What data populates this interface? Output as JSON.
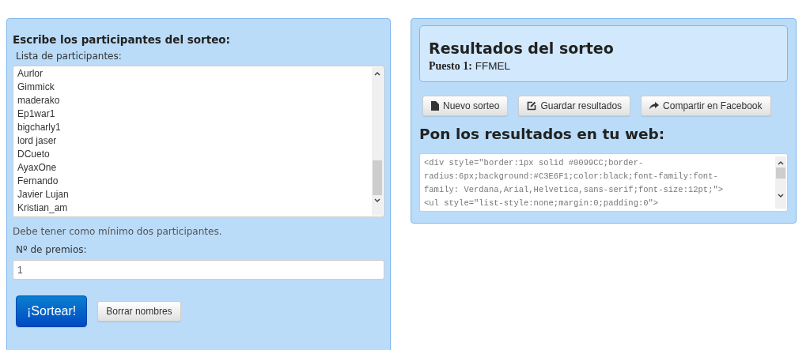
{
  "participants_panel": {
    "heading": "Escribe los participantes del sorteo:",
    "list_label": "Lista de participantes:",
    "participants": [
      "Aurlor",
      "Gimmick",
      "maderako",
      "Ep1war1",
      "bigcharly1",
      "lord jaser",
      "DCueto",
      "AyaxOne",
      "Fernando",
      "Javier Lujan",
      "Kristian_am"
    ],
    "hint": "Debe tener como mínimo dos participantes.",
    "prizes_label": "Nº de premios:",
    "prizes_value": "1",
    "buttons": [
      {
        "label": "¡Sortear!",
        "kind": "primary"
      },
      {
        "label": "Borrar nombres",
        "kind": "default"
      }
    ]
  },
  "results_panel": {
    "title": "Resultados del sorteo",
    "winners": [
      {
        "place": "Puesto 1:",
        "name": "FFMEL"
      }
    ],
    "buttons": [
      {
        "label": "Nuevo sorteo",
        "kind": "new"
      },
      {
        "label": "Guardar resultados",
        "kind": "save"
      },
      {
        "label": "Compartir en Facebook",
        "kind": "share"
      }
    ],
    "embed_heading": "Pon los resultados en tu web:",
    "embed_code": [
      "<div style=\"border:1px solid #0099CC;border-",
      "radius:6px;background:#C3E6F1;color:black;font-family:font-",
      "family: Verdana,Arial,Helvetica,sans-serif;font-size:12pt;\">",
      "<ul style=\"list-style:none;margin:0;padding:0\">"
    ]
  }
}
